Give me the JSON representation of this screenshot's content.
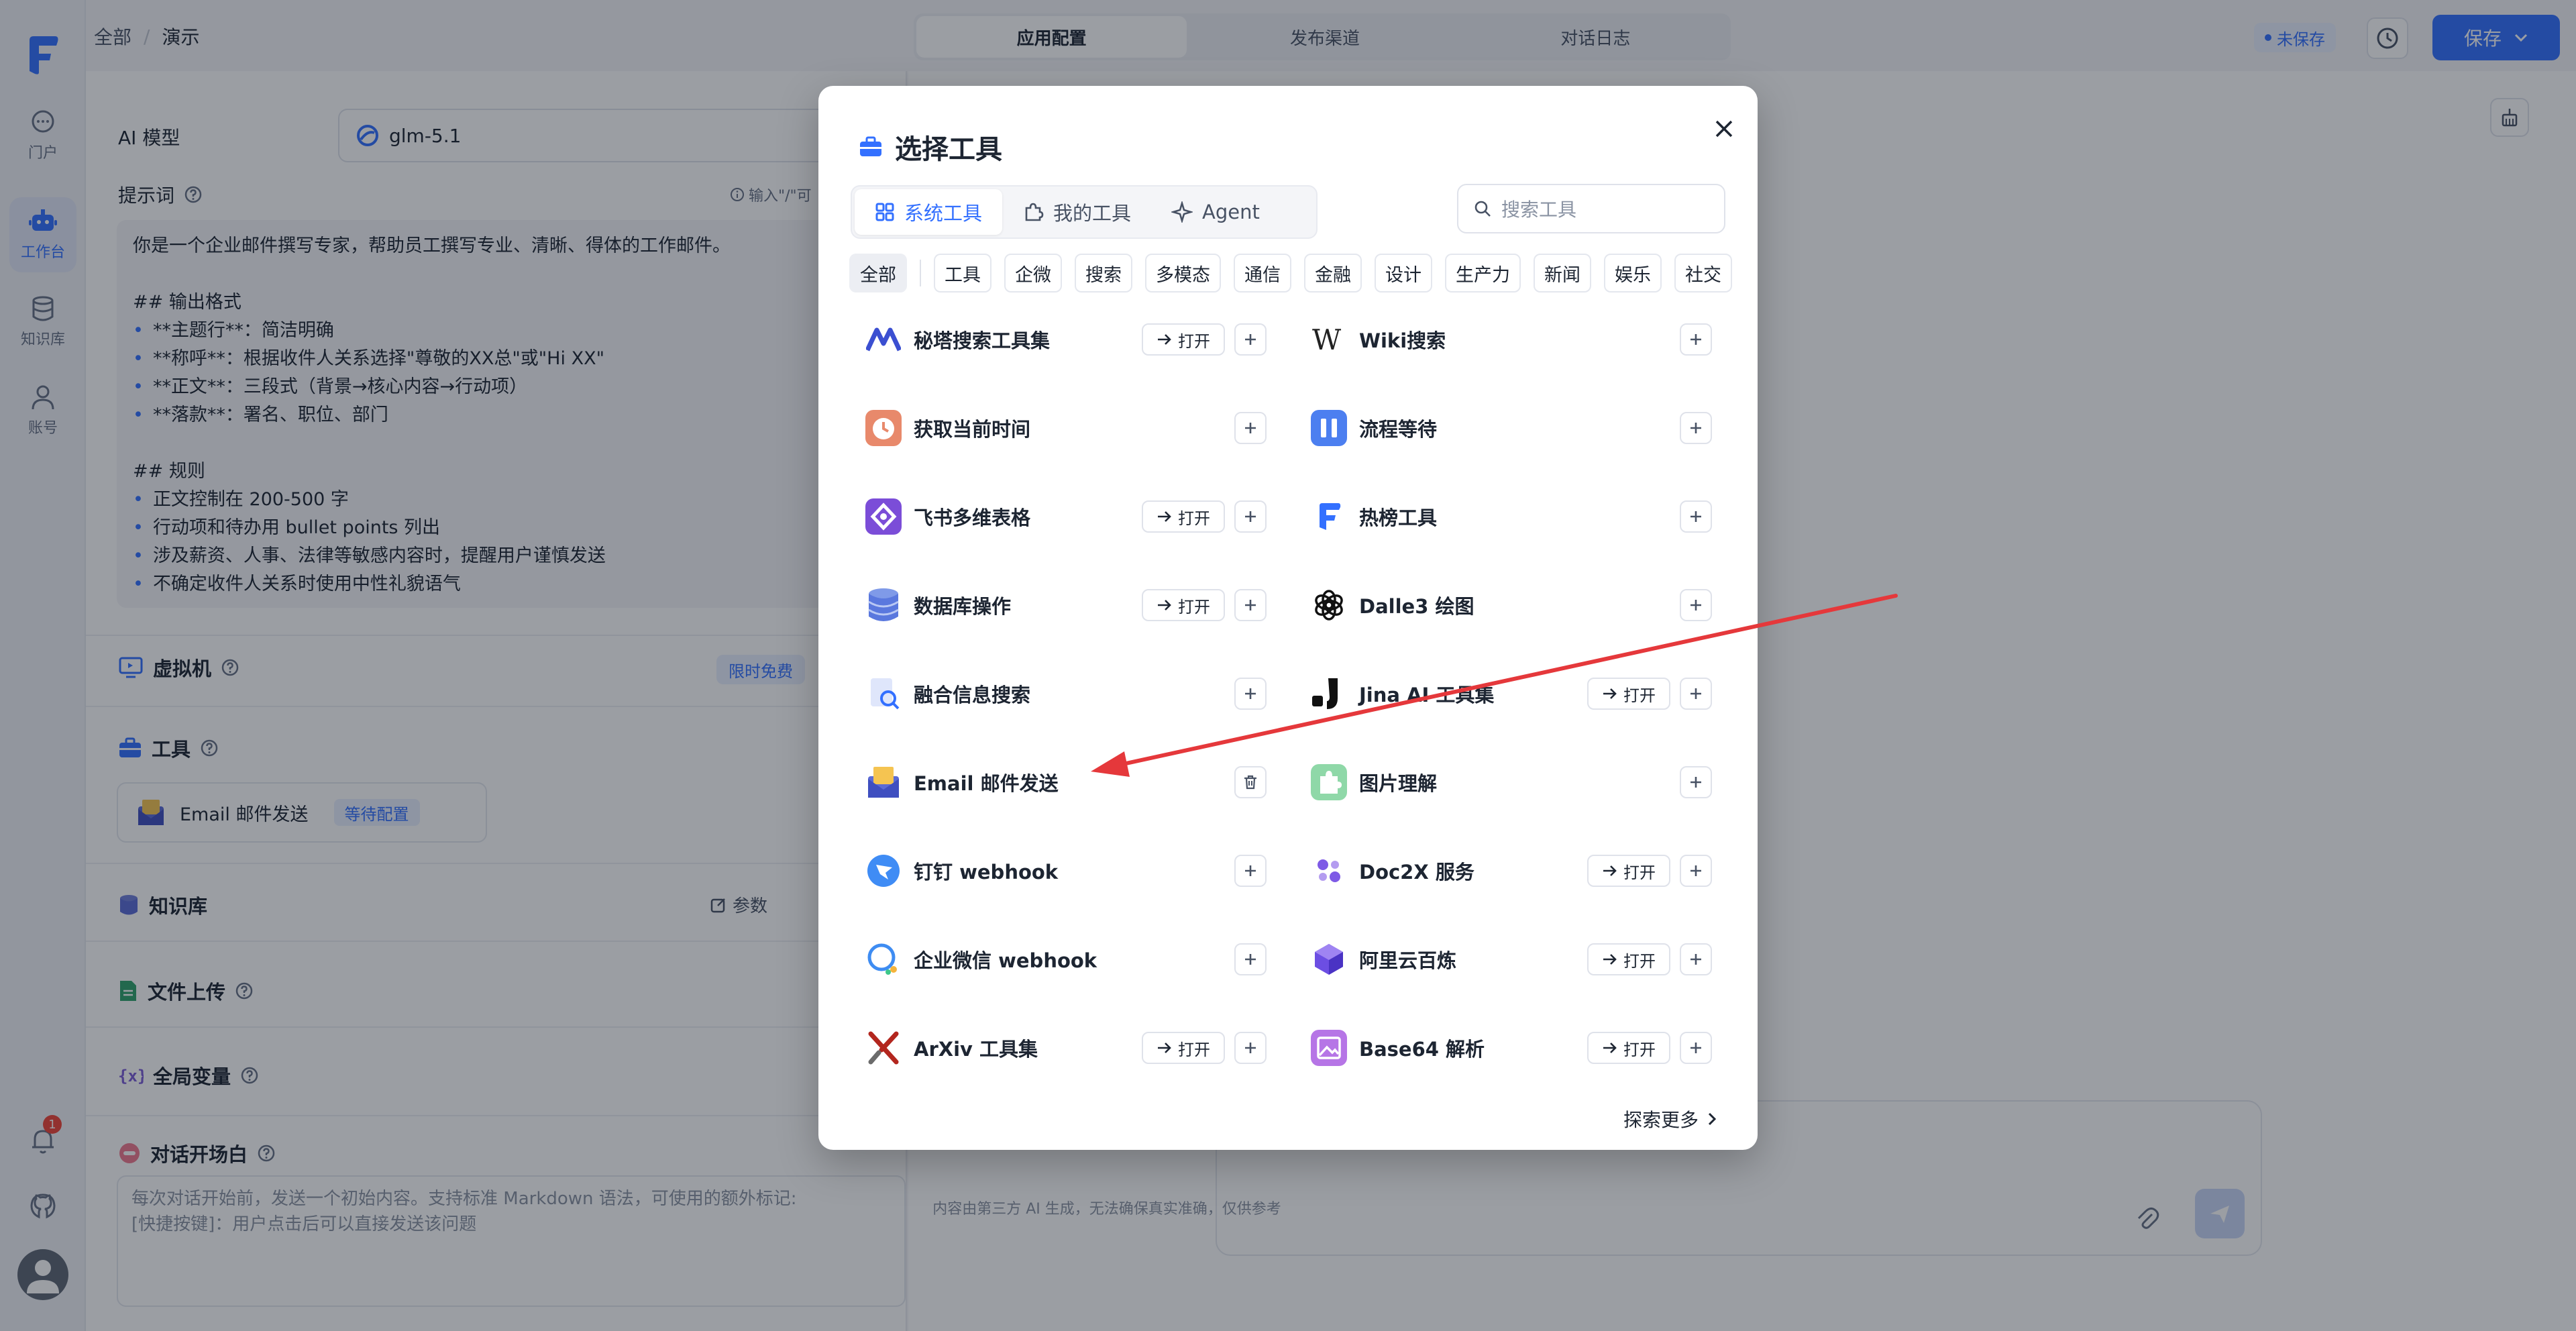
{
  "breadcrumb": {
    "root": "全部",
    "separator": "/",
    "current": "演示"
  },
  "header_tabs": [
    {
      "label": "应用配置",
      "active": true
    },
    {
      "label": "发布渠道",
      "active": false
    },
    {
      "label": "对话日志",
      "active": false
    }
  ],
  "header": {
    "unsaved_label": "未保存",
    "save_label": "保存"
  },
  "rail": {
    "items": [
      {
        "label": "门户",
        "icon": "chat-bubble-icon"
      },
      {
        "label": "工作台",
        "icon": "robot-icon",
        "active": true
      },
      {
        "label": "知识库",
        "icon": "database-icon"
      },
      {
        "label": "账号",
        "icon": "user-icon"
      }
    ],
    "notification_count": "1"
  },
  "config": {
    "ai_model_label": "AI 模型",
    "ai_model_value": "glm-5.1",
    "prompt_label": "提示词",
    "prompt_hint": "输入\"/\"可",
    "prompt_lines": [
      {
        "text": "你是一个企业邮件撰写专家，帮助员工撰写专业、清晰、得体的工作邮件。",
        "bullet": false
      },
      {
        "text": "",
        "bullet": false
      },
      {
        "text": "## 输出格式",
        "bullet": false
      },
      {
        "text": "**主题行**：简洁明确",
        "bullet": true
      },
      {
        "text": "**称呼**：根据收件人关系选择\"尊敬的XX总\"或\"Hi XX\"",
        "bullet": true
      },
      {
        "text": "**正文**：三段式（背景→核心内容→行动项）",
        "bullet": true
      },
      {
        "text": "**落款**：署名、职位、部门",
        "bullet": true
      },
      {
        "text": "",
        "bullet": false
      },
      {
        "text": "## 规则",
        "bullet": false
      },
      {
        "text": "正文控制在 200-500 字",
        "bullet": true
      },
      {
        "text": "行动项和待办用 bullet points 列出",
        "bullet": true
      },
      {
        "text": "涉及薪资、人事、法律等敏感内容时，提醒用户谨慎发送",
        "bullet": true
      },
      {
        "text": "不确定收件人关系时使用中性礼貌语气",
        "bullet": true
      }
    ],
    "vm_label": "虚拟机",
    "vm_tag": "限时免费",
    "tools_label": "工具",
    "selected_tool": {
      "name": "Email 邮件发送",
      "status": "等待配置"
    },
    "kb_label": "知识库",
    "kb_param_label": "参数",
    "file_upload_label": "文件上传",
    "global_vars_label": "全局变量",
    "opener_label": "对话开场白",
    "opener_placeholder": "每次对话开始前，发送一个初始内容。支持标准 Markdown 语法，可使用的额外标记:\n[快捷按键]：用户点击后可以直接发送该问题"
  },
  "preview": {
    "disclaimer": "内容由第三方 AI 生成，无法确保真实准确，仅供参考"
  },
  "modal": {
    "title": "选择工具",
    "tabs": [
      {
        "label": "系统工具",
        "active": true,
        "icon": "grid-icon"
      },
      {
        "label": "我的工具",
        "active": false,
        "icon": "puzzle-icon"
      },
      {
        "label": "Agent",
        "active": false,
        "icon": "sparkle-icon"
      }
    ],
    "search_placeholder": "搜索工具",
    "categories": [
      "全部",
      "工具",
      "企微",
      "搜索",
      "多模态",
      "通信",
      "金融",
      "设计",
      "生产力",
      "新闻",
      "娱乐",
      "社交"
    ],
    "active_category": "全部",
    "open_label": "打开",
    "explore_label": "探索更多",
    "tools_left": [
      {
        "name": "秘塔搜索工具集",
        "icon": "metaso-icon",
        "open": true,
        "added": false
      },
      {
        "name": "获取当前时间",
        "icon": "clock-icon",
        "open": false,
        "added": false
      },
      {
        "name": "飞书多维表格",
        "icon": "feishu-bitable-icon",
        "open": true,
        "added": false
      },
      {
        "name": "数据库操作",
        "icon": "database-icon",
        "open": true,
        "added": false
      },
      {
        "name": "融合信息搜索",
        "icon": "doc-search-icon",
        "open": false,
        "added": false
      },
      {
        "name": "Email 邮件发送",
        "icon": "email-icon",
        "open": false,
        "added": true
      },
      {
        "name": "钉钉 webhook",
        "icon": "dingtalk-icon",
        "open": false,
        "added": false
      },
      {
        "name": "企业微信 webhook",
        "icon": "wecom-icon",
        "open": false,
        "added": false
      },
      {
        "name": "ArXiv 工具集",
        "icon": "arxiv-icon",
        "open": true,
        "added": false
      }
    ],
    "tools_right": [
      {
        "name": "Wiki搜索",
        "icon": "wikipedia-icon",
        "open": false,
        "added": false
      },
      {
        "name": "流程等待",
        "icon": "pause-icon",
        "open": false,
        "added": false
      },
      {
        "name": "热榜工具",
        "icon": "fastgpt-icon",
        "open": false,
        "added": false
      },
      {
        "name": "Dalle3 绘图",
        "icon": "openai-icon",
        "open": false,
        "added": false
      },
      {
        "name": "Jina AI 工具集",
        "icon": "jina-icon",
        "open": true,
        "added": false
      },
      {
        "name": "图片理解",
        "icon": "puzzle-green-icon",
        "open": false,
        "added": false
      },
      {
        "name": "Doc2X 服务",
        "icon": "doc2x-icon",
        "open": true,
        "added": false
      },
      {
        "name": "阿里云百炼",
        "icon": "bailian-icon",
        "open": true,
        "added": false
      },
      {
        "name": "Base64 解析",
        "icon": "image-icon",
        "open": true,
        "added": false
      }
    ]
  },
  "colors": {
    "accent": "#3370ff",
    "annotation_arrow": "#e5383b"
  }
}
